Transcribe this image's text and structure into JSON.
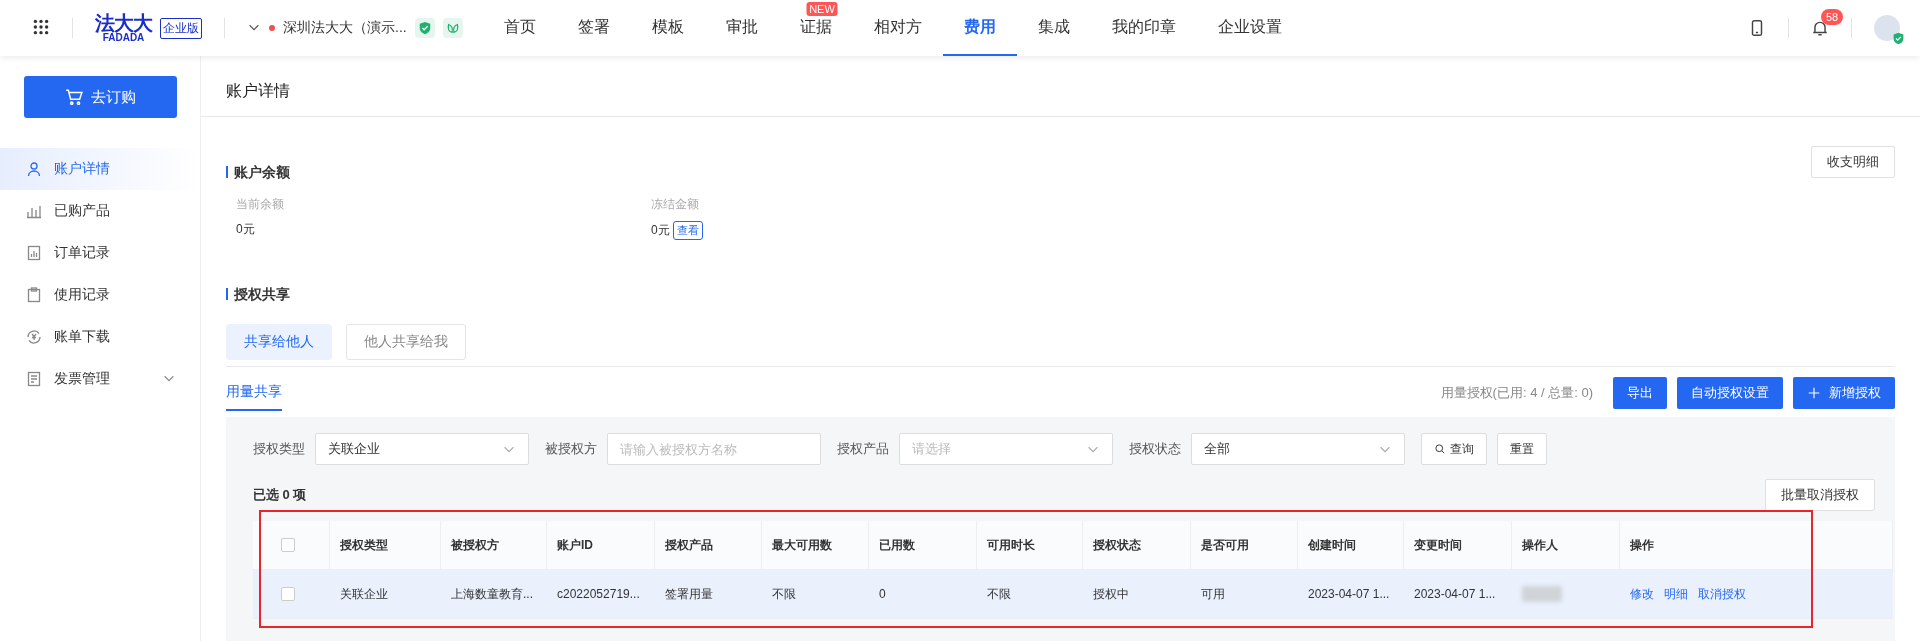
{
  "header": {
    "logo": {
      "name": "法大大",
      "latin": "FADADA",
      "edition": "企业版"
    },
    "company": {
      "name": "深圳法大大（演示..."
    },
    "nav": [
      {
        "label": "首页",
        "selected": false
      },
      {
        "label": "签署",
        "selected": false
      },
      {
        "label": "模板",
        "selected": false
      },
      {
        "label": "审批",
        "selected": false
      },
      {
        "label": "证据",
        "selected": false,
        "badge": "NEW"
      },
      {
        "label": "相对方",
        "selected": false
      },
      {
        "label": "费用",
        "selected": true
      },
      {
        "label": "集成",
        "selected": false
      },
      {
        "label": "我的印章",
        "selected": false
      },
      {
        "label": "企业设置",
        "selected": false
      }
    ],
    "notifications": {
      "count": "58"
    }
  },
  "sidebar": {
    "order_button": "去订购",
    "items": [
      {
        "label": "账户详情",
        "selected": true,
        "kind": "link"
      },
      {
        "label": "已购产品",
        "selected": false,
        "kind": "link"
      },
      {
        "label": "订单记录",
        "selected": false,
        "kind": "link"
      },
      {
        "label": "使用记录",
        "selected": false,
        "kind": "link"
      },
      {
        "label": "账单下载",
        "selected": false,
        "kind": "link"
      },
      {
        "label": "发票管理",
        "selected": false,
        "kind": "group",
        "expanded": false
      }
    ]
  },
  "page": {
    "title": "账户详情"
  },
  "balance": {
    "title": "账户余额",
    "button": "收支明细",
    "fields": [
      {
        "label": "当前余额",
        "value": "0元"
      },
      {
        "label": "冻结金额",
        "value": "0元",
        "link": "查看"
      }
    ]
  },
  "sharing": {
    "title": "授权共享",
    "tabs": [
      {
        "label": "共享给他人",
        "selected": true
      },
      {
        "label": "他人共享给我",
        "selected": false
      }
    ],
    "subtabs": [
      {
        "label": "用量共享",
        "selected": true
      }
    ],
    "quota": "用量授权(已用: 4 / 总量: 0)",
    "buttons": [
      {
        "label": "导出",
        "kind": "plain"
      },
      {
        "label": "自动授权设置",
        "kind": "plain"
      },
      {
        "label": "新增授权",
        "kind": "add"
      }
    ]
  },
  "filters": [
    {
      "label": "授权类型",
      "kind": "select",
      "value": "关联企业"
    },
    {
      "label": "被授权方",
      "kind": "input",
      "placeholder": "请输入被授权方名称"
    },
    {
      "label": "授权产品",
      "kind": "select",
      "placeholder": "请选择"
    },
    {
      "label": "授权状态",
      "kind": "select",
      "value": "全部"
    }
  ],
  "filter_buttons": [
    {
      "label": "查询",
      "kind": "search"
    },
    {
      "label": "重置",
      "kind": "plain"
    }
  ],
  "selection": {
    "text": "已选 0 项",
    "batch_button": "批量取消授权"
  },
  "table": {
    "all_checked": false,
    "columns": [
      "授权类型",
      "被授权方",
      "账户ID",
      "授权产品",
      "最大可用数",
      "已用数",
      "可用时长",
      "授权状态",
      "是否可用",
      "创建时间",
      "变更时间",
      "操作人",
      "操作"
    ],
    "rows": [
      {
        "checked": false,
        "highlighted": true,
        "cells": [
          "关联企业",
          "上海数童教育...",
          "c2022052719...",
          "签署用量",
          "不限",
          "0",
          "不限",
          "授权中",
          "可用",
          "2023-04-07 1...",
          "2023-04-07 1..."
        ],
        "actions": [
          "修改",
          "明细",
          "取消授权"
        ]
      }
    ]
  }
}
